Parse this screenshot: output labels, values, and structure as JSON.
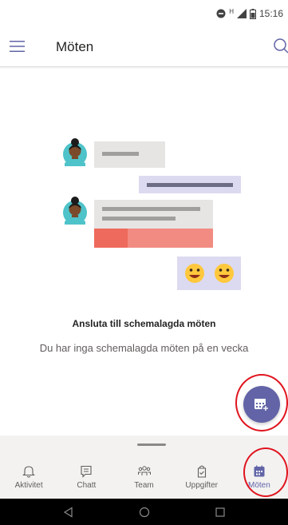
{
  "status_bar": {
    "time": "15:16",
    "network_label": "H",
    "icons": [
      "do-not-disturb-icon",
      "signal-icon",
      "battery-icon"
    ]
  },
  "app_bar": {
    "title": "Möten",
    "menu_icon": "hamburger-menu-icon",
    "search_icon": "search-icon"
  },
  "empty_state": {
    "title": "Ansluta till schemalagda möten",
    "subtitle": "Du har inga schemalagda möten på en vecka"
  },
  "fab": {
    "icon": "calendar-add-icon"
  },
  "tabs": [
    {
      "label": "Aktivitet",
      "icon": "bell-icon",
      "active": false
    },
    {
      "label": "Chatt",
      "icon": "chat-icon",
      "active": false
    },
    {
      "label": "Team",
      "icon": "team-icon",
      "active": false
    },
    {
      "label": "Uppgifter",
      "icon": "tasks-icon",
      "active": false
    },
    {
      "label": "Möten",
      "icon": "calendar-icon",
      "active": true
    }
  ],
  "colors": {
    "accent": "#6264a7",
    "annotation": "#e0141e",
    "tab_background": "#f3f2f1"
  },
  "system_nav": [
    "back-icon",
    "home-icon",
    "recents-icon"
  ]
}
